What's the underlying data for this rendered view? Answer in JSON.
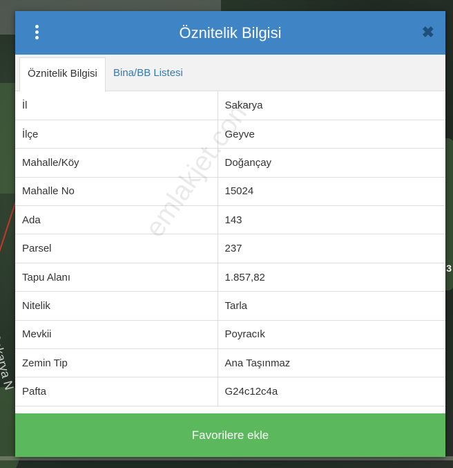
{
  "dialog": {
    "title": "Öznitelik Bilgisi",
    "menu_icon": "kebab-menu-icon",
    "close_icon": "close-icon",
    "close_glyph": "✖"
  },
  "tabs": [
    {
      "label": "Öznitelik Bilgisi",
      "active": true
    },
    {
      "label": "Bina/BB Listesi",
      "active": false
    }
  ],
  "attributes": [
    {
      "key": "İl",
      "value": "Sakarya"
    },
    {
      "key": "İlçe",
      "value": "Geyve"
    },
    {
      "key": "Mahalle/Köy",
      "value": "Doğançay"
    },
    {
      "key": "Mahalle No",
      "value": "15024"
    },
    {
      "key": "Ada",
      "value": "143"
    },
    {
      "key": "Parsel",
      "value": "237"
    },
    {
      "key": "Tapu Alanı",
      "value": "1.857,82"
    },
    {
      "key": "Nitelik",
      "value": "Tarla"
    },
    {
      "key": "Mevkii",
      "value": "Poyracık"
    },
    {
      "key": "Zemin Tip",
      "value": "Ana Taşınmaz"
    },
    {
      "key": "Pafta",
      "value": "G24c12c4a"
    }
  ],
  "footer": {
    "button_label": "Favorilere ekle"
  },
  "map": {
    "street_label": "Sakarya N",
    "edge_digit": "3"
  },
  "watermark": "emlakjet.com",
  "colors": {
    "header": "#3f85c6",
    "footer": "#5cb85c",
    "link": "#337ab7"
  }
}
